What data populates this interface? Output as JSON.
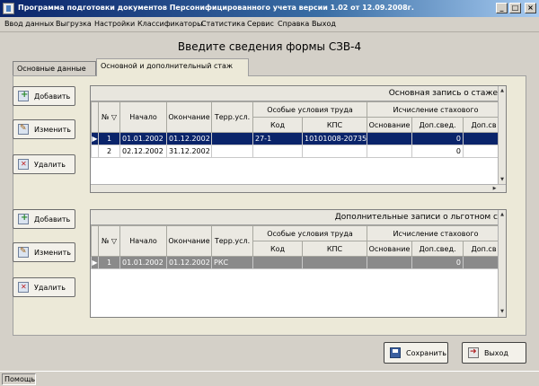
{
  "window": {
    "title": "Программа подготовки документов Персонифицированного учета версии 1.02 от 12.09.2008г.",
    "min_glyph": "_",
    "max_glyph": "□",
    "close_glyph": "×"
  },
  "menu": [
    "Ввод данных",
    "Выгрузка",
    "Настройки",
    "Классификаторы",
    "Статистика",
    "Сервис",
    "Справка",
    "Выход"
  ],
  "form_title": "Введите сведения формы СЗВ-4",
  "tabs": [
    {
      "label": "Основные данные",
      "active": false
    },
    {
      "label": "Основной и дополнительный стаж",
      "active": true
    }
  ],
  "side_buttons": {
    "top": {
      "add": "Добавить",
      "edit": "Изменить",
      "delete": "Удалить"
    },
    "bottom": {
      "add": "Добавить",
      "edit": "Изменить",
      "delete": "Удалить"
    }
  },
  "columns": {
    "num": "№",
    "start": "Начало",
    "end": "Окончание",
    "terr": "Терр.усл.",
    "special_group": "Особые условия труда",
    "code": "Код",
    "kps": "КПС",
    "calc_group": "Исчисление стахового",
    "basis": "Основание",
    "extra1": "Доп.свед.",
    "extra2": "Доп.св"
  },
  "main_grid": {
    "caption": "Основная запись о стаже",
    "rows": [
      {
        "num": "1",
        "start": "01.01.2002",
        "end": "01.12.2002",
        "terr": "",
        "code": "27-1",
        "kps": "10101008-20735",
        "basis": "",
        "extra1": "0",
        "extra2": "",
        "selected": true
      },
      {
        "num": "2",
        "start": "02.12.2002",
        "end": "31.12.2002",
        "terr": "",
        "code": "",
        "kps": "",
        "basis": "",
        "extra1": "0",
        "extra2": "",
        "selected": false
      }
    ]
  },
  "extra_grid": {
    "caption": "Дополнительные записи о льготном с",
    "rows": [
      {
        "num": "1",
        "start": "01.01.2002",
        "end": "01.12.2002",
        "terr": "РКС",
        "code": "",
        "kps": "",
        "basis": "",
        "extra1": "0",
        "extra2": "",
        "selected": true
      }
    ]
  },
  "bottom_buttons": {
    "save": "Сохранить",
    "exit": "Выход"
  },
  "status": "Помощь"
}
